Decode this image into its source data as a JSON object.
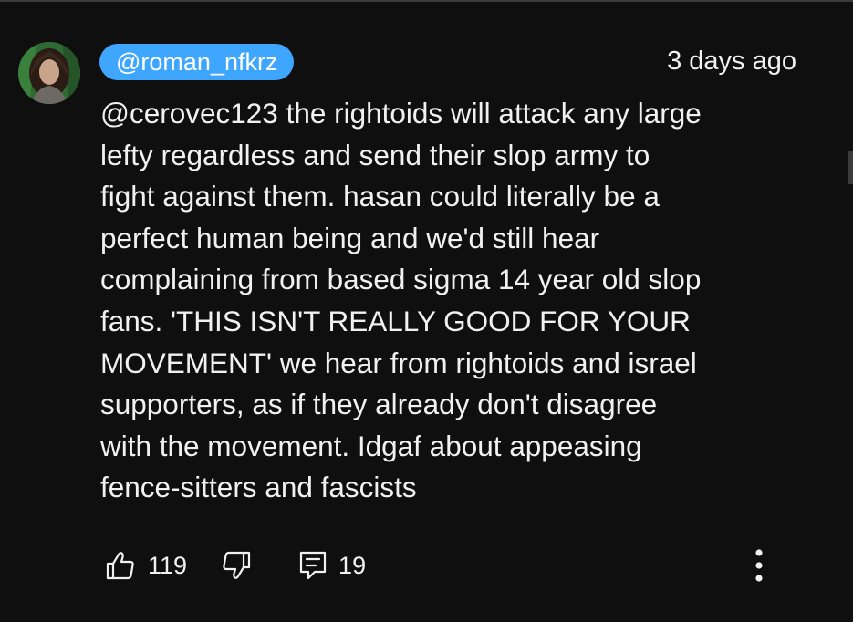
{
  "comment": {
    "author_handle": "@roman_nfkrz",
    "timestamp": "3 days ago",
    "lines": [
      "@cerovec123 the rightoids will attack any large",
      "lefty regardless and send their slop army to",
      "fight against them. hasan could literally be a",
      "perfect human being and we'd still hear",
      "complaining from based sigma 14 year old slop",
      "fans. 'THIS ISN'T REALLY GOOD FOR YOUR",
      "MOVEMENT' we hear from rightoids and israel",
      "supporters, as if they already don't disagree",
      "with the movement. Idgaf about appeasing",
      "fence-sitters and fascists"
    ]
  },
  "actions": {
    "like_count": "119",
    "reply_count": "19"
  },
  "icons": {
    "like": "thumbs-up-icon",
    "dislike": "thumbs-down-icon",
    "reply": "comment-icon",
    "more": "more-vertical-icon"
  },
  "colors": {
    "background": "#0f0f0f",
    "text": "#f1f1f1",
    "handle_chip": "#3ea6ff"
  }
}
